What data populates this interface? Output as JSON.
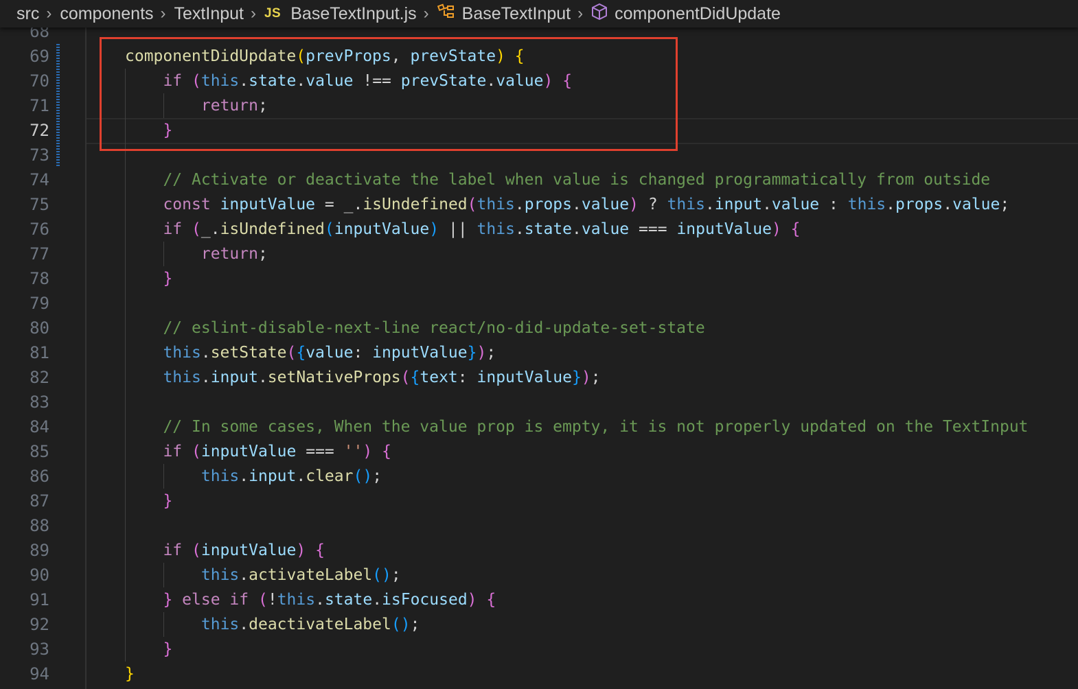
{
  "breadcrumb": {
    "items": [
      "src",
      "components",
      "TextInput",
      "BaseTextInput.js",
      "BaseTextInput",
      "componentDidUpdate"
    ],
    "js_badge": "JS"
  },
  "editor": {
    "active_line": "72",
    "line_numbers": [
      "68",
      "69",
      "70",
      "71",
      "72",
      "73",
      "74",
      "75",
      "76",
      "77",
      "78",
      "79",
      "80",
      "81",
      "82",
      "83",
      "84",
      "85",
      "86",
      "87",
      "88",
      "89",
      "90",
      "91",
      "92",
      "93",
      "94"
    ],
    "code": [
      "",
      "componentDidUpdate(prevProps, prevState) {",
      "    if (this.state.value !== prevState.value) {",
      "        return;",
      "    }",
      "",
      "    // Activate or deactivate the label when value is changed programmatically from outside",
      "    const inputValue = _.isUndefined(this.props.value) ? this.input.value : this.props.value;",
      "    if (_.isUndefined(inputValue) || this.state.value === inputValue) {",
      "        return;",
      "    }",
      "",
      "    // eslint-disable-next-line react/no-did-update-set-state",
      "    this.setState({value: inputValue});",
      "    this.input.setNativeProps({text: inputValue});",
      "",
      "    // In some cases, When the value prop is empty, it is not properly updated on the TextInput",
      "    if (inputValue === '') {",
      "        this.input.clear();",
      "    }",
      "",
      "    if (inputValue) {",
      "        this.activateLabel();",
      "    } else if (!this.state.isFocused) {",
      "        this.deactivateLabel();",
      "    }",
      "}"
    ]
  },
  "colors": {
    "background": "#1f1f1f",
    "highlight_box": "#e0402e",
    "keyword": "#c586c0",
    "builtin": "#569cd6",
    "function": "#dcdcaa",
    "variable": "#9cdcfe",
    "comment": "#6a9955",
    "string": "#ce9178"
  },
  "icons": [
    "chevron-right-icon",
    "js-file-icon",
    "class-icon",
    "method-cube-icon"
  ]
}
